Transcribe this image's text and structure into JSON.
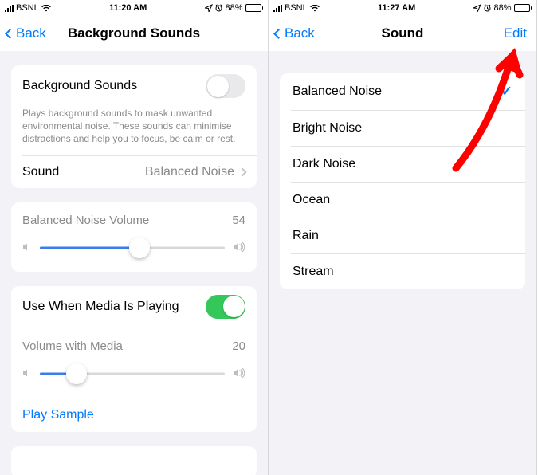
{
  "left": {
    "status": {
      "carrier": "BSNL",
      "time": "11:20 AM",
      "battery_pct": "88%",
      "battery_fill": 88
    },
    "nav": {
      "back": "Back",
      "title": "Background Sounds"
    },
    "bg_sounds": {
      "toggle_label": "Background Sounds",
      "toggle_on": false,
      "description": "Plays background sounds to mask unwanted environmental noise. These sounds can minimise distractions and help you to focus, be calm or rest.",
      "sound_label": "Sound",
      "sound_value": "Balanced Noise"
    },
    "volume": {
      "label": "Balanced Noise Volume",
      "value": "54",
      "pct": 54
    },
    "media": {
      "toggle_label": "Use When Media Is Playing",
      "toggle_on": true,
      "slider_label": "Volume with Media",
      "slider_value": "20",
      "slider_pct": 20,
      "play_sample": "Play Sample"
    }
  },
  "right": {
    "status": {
      "carrier": "BSNL",
      "time": "11:27 AM",
      "battery_pct": "88%",
      "battery_fill": 88
    },
    "nav": {
      "back": "Back",
      "title": "Sound",
      "edit": "Edit"
    },
    "sounds": [
      {
        "name": "Balanced Noise",
        "selected": true
      },
      {
        "name": "Bright Noise",
        "selected": false
      },
      {
        "name": "Dark Noise",
        "selected": false
      },
      {
        "name": "Ocean",
        "selected": false
      },
      {
        "name": "Rain",
        "selected": false
      },
      {
        "name": "Stream",
        "selected": false
      }
    ]
  }
}
